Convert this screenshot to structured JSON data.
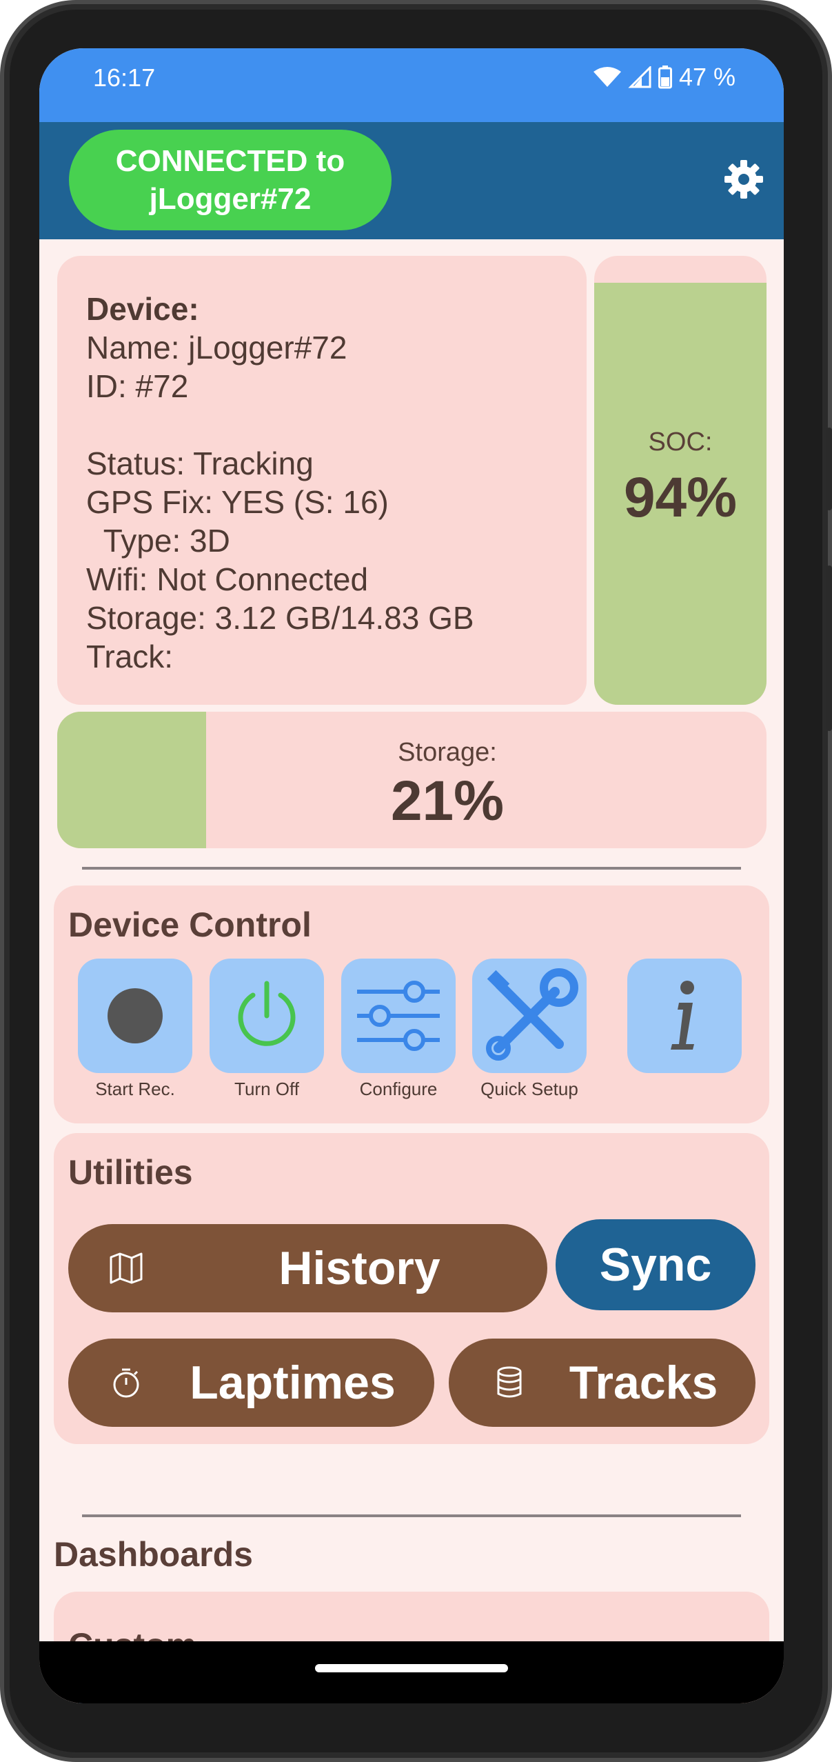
{
  "status_bar": {
    "time": "16:17",
    "battery_percent": "47 %"
  },
  "app_bar": {
    "connection_line1": "CONNECTED to",
    "connection_line2": "jLogger#72"
  },
  "device": {
    "heading": "Device:",
    "name": "Name: jLogger#72",
    "id": "ID: #72",
    "status": "Status: Tracking",
    "gps_fix": "GPS Fix: YES (S: 16)",
    "gps_type": "  Type: 3D",
    "wifi": "Wifi: Not Connected",
    "storage": "Storage: 3.12 GB/14.83 GB",
    "track": "Track:"
  },
  "soc": {
    "label": "SOC:",
    "value": "94%",
    "level": 0.94
  },
  "storage": {
    "label": "Storage:",
    "value": "21%",
    "level": 0.21
  },
  "device_control": {
    "title": "Device Control",
    "buttons": [
      {
        "label": "Start Rec.",
        "icon": "record-icon"
      },
      {
        "label": "Turn Off",
        "icon": "power-icon"
      },
      {
        "label": "Configure",
        "icon": "sliders-icon"
      },
      {
        "label": "Quick Setup",
        "icon": "tools-icon"
      },
      {
        "label": "",
        "icon": "info-icon"
      }
    ]
  },
  "utilities": {
    "title": "Utilities",
    "history_label": "History",
    "sync_label": "Sync",
    "laptimes_label": "Laptimes",
    "tracks_label": "Tracks"
  },
  "dashboards": {
    "title": "Dashboards",
    "custom_title": "Custom"
  },
  "colors": {
    "status_bar": "#4090f0",
    "app_bar": "#1f6394",
    "connected": "#48d150",
    "card": "#fbd8d5",
    "level_fill": "#bad18f",
    "brown_button": "#7e5338",
    "blue_button": "#1f6394"
  }
}
